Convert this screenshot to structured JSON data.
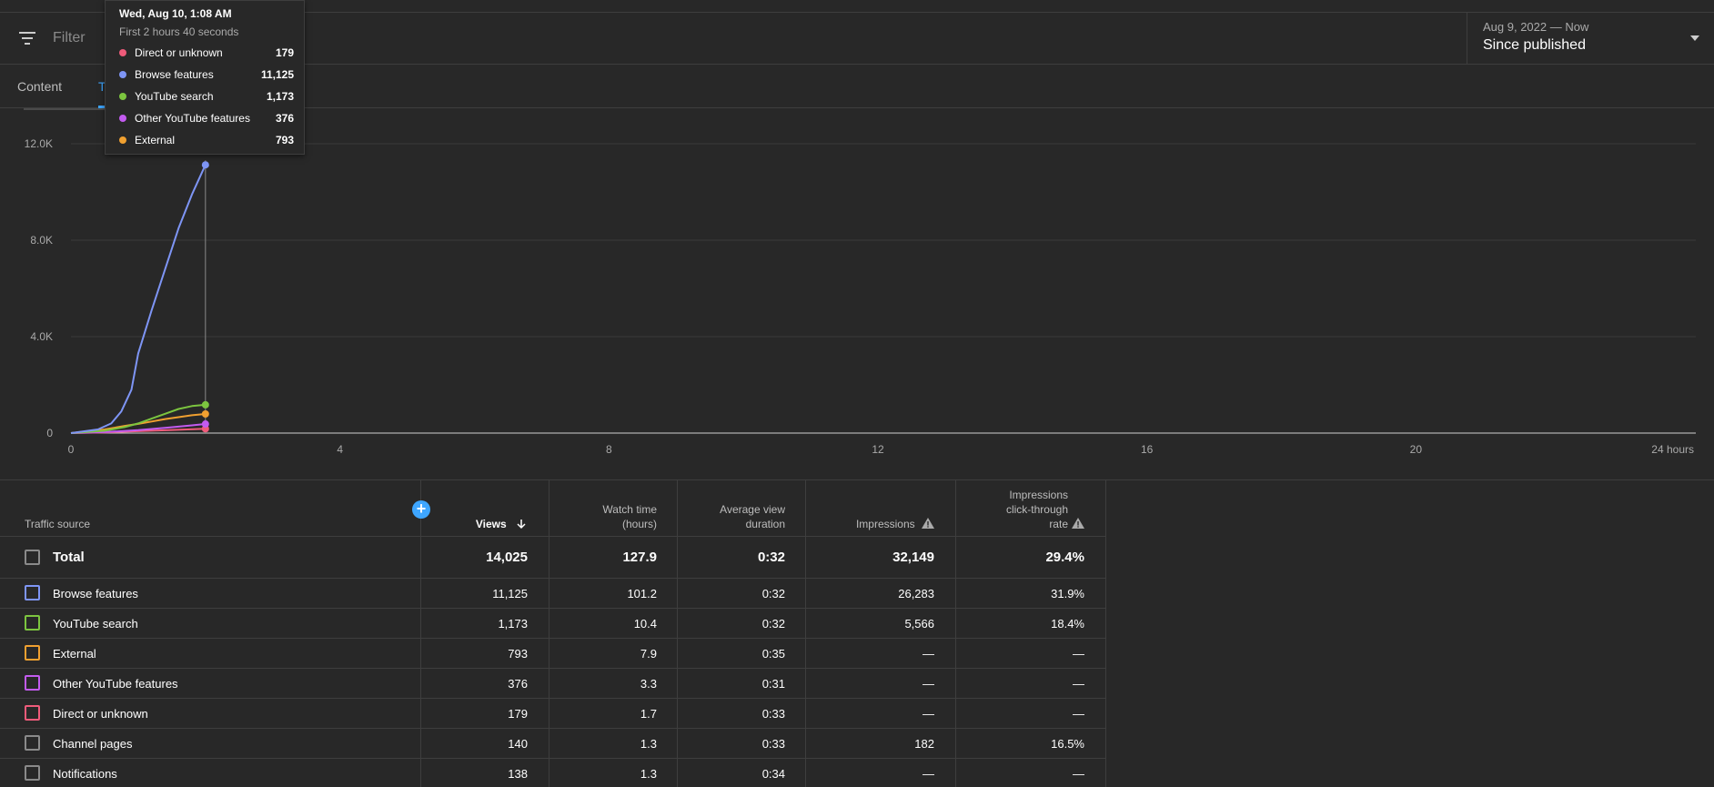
{
  "filter": {
    "label": "Filter"
  },
  "date_picker": {
    "range": "Aug 9, 2022 — Now",
    "value": "Since published"
  },
  "tabs": [
    {
      "label": "Content"
    },
    {
      "label": "T"
    }
  ],
  "tooltip": {
    "title": "Wed, Aug 10, 1:08 AM",
    "subtitle": "First 2 hours 40 seconds",
    "items": [
      {
        "name": "Direct or unknown",
        "value": "179",
        "color": "#ef5b7a"
      },
      {
        "name": "Browse features",
        "value": "11,125",
        "color": "#7e95f5"
      },
      {
        "name": "YouTube search",
        "value": "1,173",
        "color": "#7cc53f"
      },
      {
        "name": "Other YouTube features",
        "value": "376",
        "color": "#c35bf0"
      },
      {
        "name": "External",
        "value": "793",
        "color": "#f0a030"
      }
    ]
  },
  "chart_data": {
    "type": "line",
    "x_tick_labels": [
      "0",
      "4",
      "8",
      "12",
      "16",
      "20",
      "24 hours"
    ],
    "y_tick_labels": [
      "0",
      "4.0K",
      "8.0K",
      "12.0K"
    ],
    "xlim": [
      0,
      24
    ],
    "ylim": [
      0,
      12000
    ],
    "hover_x": 2,
    "grid": true,
    "series": [
      {
        "name": "Browse features",
        "color": "#7e95f5",
        "x": [
          0,
          0.4,
          0.6,
          0.75,
          0.9,
          1.0,
          1.2,
          1.4,
          1.6,
          1.8,
          2.0
        ],
        "y": [
          0,
          150,
          400,
          900,
          1800,
          3300,
          5100,
          6800,
          8500,
          9900,
          11125
        ]
      },
      {
        "name": "YouTube search",
        "color": "#7cc53f",
        "x": [
          0,
          0.5,
          0.8,
          1.0,
          1.2,
          1.4,
          1.6,
          1.8,
          2.0
        ],
        "y": [
          0,
          100,
          250,
          400,
          600,
          800,
          1000,
          1120,
          1173
        ]
      },
      {
        "name": "External",
        "color": "#f0a030",
        "x": [
          0,
          0.5,
          0.8,
          1.0,
          1.2,
          1.4,
          1.6,
          1.8,
          2.0
        ],
        "y": [
          0,
          150,
          300,
          380,
          480,
          580,
          660,
          740,
          793
        ]
      },
      {
        "name": "Other YouTube features",
        "color": "#c35bf0",
        "x": [
          0,
          0.5,
          1.0,
          1.4,
          1.8,
          2.0
        ],
        "y": [
          0,
          40,
          120,
          220,
          320,
          376
        ]
      },
      {
        "name": "Direct or unknown",
        "color": "#ef5b7a",
        "x": [
          0,
          0.5,
          1.0,
          1.5,
          2.0
        ],
        "y": [
          0,
          30,
          80,
          130,
          179
        ]
      }
    ]
  },
  "table": {
    "headers": {
      "source": "Traffic source",
      "views": "Views",
      "watch_l1": "Watch time",
      "watch_l2": "(hours)",
      "avd_l1": "Average view",
      "avd_l2": "duration",
      "impressions": "Impressions",
      "ctr_l1": "Impressions",
      "ctr_l2": "click-through",
      "ctr_l3": "rate"
    },
    "total": {
      "label": "Total",
      "views": "14,025",
      "watch": "127.9",
      "avd": "0:32",
      "impressions": "32,149",
      "ctr": "29.4%"
    },
    "rows": [
      {
        "label": "Browse features",
        "views": "11,125",
        "watch": "101.2",
        "avd": "0:32",
        "impressions": "26,283",
        "ctr": "31.9%",
        "color": "#7e95f5"
      },
      {
        "label": "YouTube search",
        "views": "1,173",
        "watch": "10.4",
        "avd": "0:32",
        "impressions": "5,566",
        "ctr": "18.4%",
        "color": "#7cc53f"
      },
      {
        "label": "External",
        "views": "793",
        "watch": "7.9",
        "avd": "0:35",
        "impressions": "—",
        "ctr": "—",
        "color": "#f0a030"
      },
      {
        "label": "Other YouTube features",
        "views": "376",
        "watch": "3.3",
        "avd": "0:31",
        "impressions": "—",
        "ctr": "—",
        "color": "#c35bf0"
      },
      {
        "label": "Direct or unknown",
        "views": "179",
        "watch": "1.7",
        "avd": "0:33",
        "impressions": "—",
        "ctr": "—",
        "color": "#ef5b7a"
      },
      {
        "label": "Channel pages",
        "views": "140",
        "watch": "1.3",
        "avd": "0:33",
        "impressions": "182",
        "ctr": "16.5%",
        "color": "#8a8a8a"
      },
      {
        "label": "Notifications",
        "views": "138",
        "watch": "1.3",
        "avd": "0:34",
        "impressions": "—",
        "ctr": "—",
        "color": "#8a8a8a"
      }
    ]
  }
}
